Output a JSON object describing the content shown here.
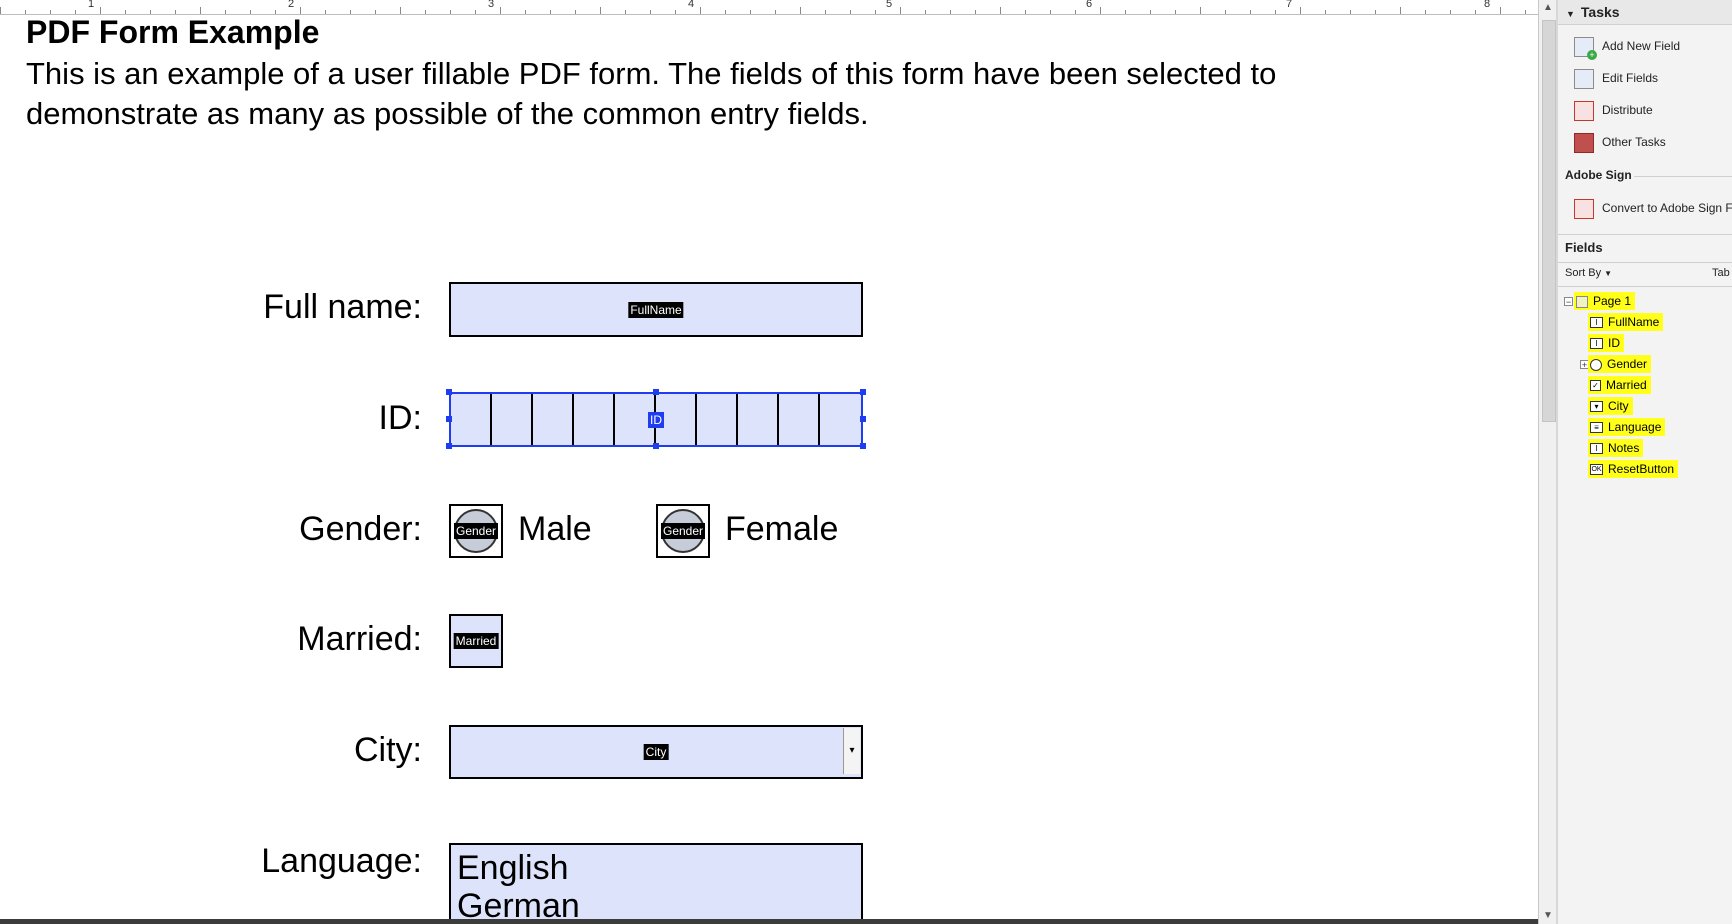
{
  "document": {
    "title": "PDF Form Example",
    "description": "This is an example of a user fillable PDF form. The fields of this form have been selected to demonstrate as many as possible of the common entry fields.",
    "ruler_numbers": [
      "1",
      "2",
      "3",
      "4",
      "5",
      "6",
      "7",
      "8"
    ],
    "labels": {
      "full_name": "Full name:",
      "id": "ID:",
      "gender": "Gender:",
      "married": "Married:",
      "city": "City:",
      "language": "Language:"
    },
    "field_tags": {
      "full_name": "FullName",
      "id": "ID",
      "gender_male": "Gender",
      "gender_female": "Gender",
      "married": "Married",
      "city": "City"
    },
    "gender_options": [
      "Male",
      "Female"
    ],
    "language_options": [
      "English",
      "German"
    ]
  },
  "panel": {
    "tasks_header": "Tasks",
    "tasks": [
      {
        "label": "Add New Field",
        "icon": "add-field-icon"
      },
      {
        "label": "Edit Fields",
        "icon": "edit-fields-icon"
      },
      {
        "label": "Distribute",
        "icon": "distribute-icon"
      },
      {
        "label": "Other Tasks",
        "icon": "toolbox-icon"
      }
    ],
    "adobe_sign_header": "Adobe Sign",
    "adobe_sign_task": "Convert to Adobe Sign F",
    "fields_header": "Fields",
    "sort_by": "Sort By",
    "tab_label": "Tab",
    "tree": {
      "root": "Page 1",
      "items": [
        "FullName",
        "ID",
        "Gender",
        "Married",
        "City",
        "Language",
        "Notes",
        "ResetButton"
      ]
    }
  },
  "colors": {
    "field_fill": "#dde3fb",
    "selection_blue": "#1f3df0",
    "highlight_yellow": "#ffff1a"
  }
}
